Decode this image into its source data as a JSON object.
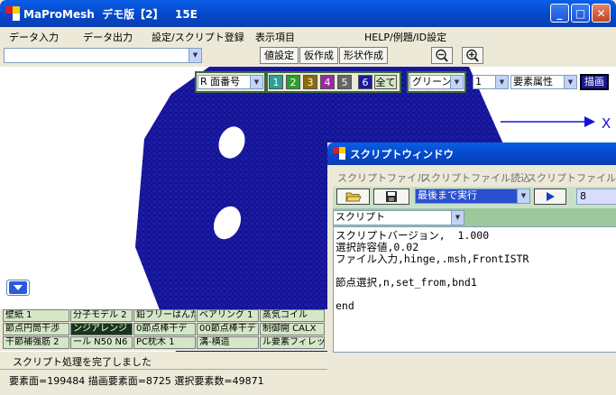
{
  "title": "MaProMesh  デモ版【2】   15E",
  "window_buttons": {
    "minimize": "_",
    "maximize": "□",
    "close": "✕"
  },
  "menu": [
    "データ入力",
    "データ出力",
    "設定/スクリプト登録",
    "表示項目",
    "HELP/例題/ID設定"
  ],
  "toolbar": {
    "combo_value": "",
    "btn_value": "値設定",
    "btn_temp": "仮作成",
    "btn_shape": "形状作成"
  },
  "viewport_controls": {
    "face_select": "R 面番号",
    "numbers": [
      "1",
      "2",
      "3",
      "4",
      "5",
      "6"
    ],
    "all_label": "全て",
    "color_select": "グリーン",
    "num_select": "1",
    "attr_select": "要素属性",
    "draw_button": "描画",
    "axis_x": "X"
  },
  "colors": {
    "mesh": "#1818a8",
    "n1": "#2aa198",
    "n2": "#2e9e2e",
    "n3": "#8a6a10",
    "n4": "#9a2aa0",
    "n5": "#666666",
    "n6": "#1a1aa0"
  },
  "grid_buttons": [
    [
      "壁紙 1",
      "分子モデル 2",
      "鉛フリーはんだ",
      "ベアリング 1",
      "蒸気コイル"
    ],
    [
      "節点円筒干渉",
      "ンジアレンジ",
      "0節点棒干デ",
      "00節点棒干デ",
      "制御開 CALX"
    ],
    [
      "干節補強筋 2",
      "ール N50 N6",
      "PC枕木 1",
      "溝-横造",
      "ル要素フィレッ"
    ]
  ],
  "status_message": "スクリプト処理を完了しました",
  "status_counts": "要素面=199484 描画要素面=8725 選択要素数=49871",
  "script_window": {
    "title": "スクリプトウィンドウ",
    "menu": [
      "スクリプトファイル",
      "スクリプトファイル読込",
      "スクリプトファイル切替"
    ],
    "run_select": "最後まで実行",
    "count_value": "8",
    "mode_select": "スクリプト",
    "lines": [
      "スクリプトバージョン,  1.000",
      "選択許容値,0.02",
      "ファイル入力,hinge,.msh,FrontISTR",
      "",
      "節点選択,n,set_from,bnd1",
      "",
      "end"
    ]
  }
}
